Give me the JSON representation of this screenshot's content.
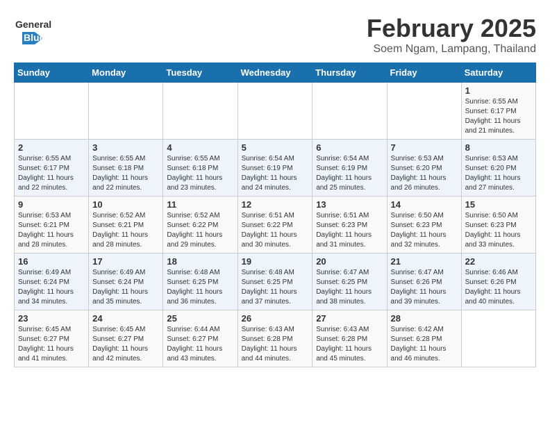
{
  "header": {
    "logo_general": "General",
    "logo_blue": "Blue",
    "month_title": "February 2025",
    "location": "Soem Ngam, Lampang, Thailand"
  },
  "days_of_week": [
    "Sunday",
    "Monday",
    "Tuesday",
    "Wednesday",
    "Thursday",
    "Friday",
    "Saturday"
  ],
  "weeks": [
    [
      {
        "day": "",
        "info": ""
      },
      {
        "day": "",
        "info": ""
      },
      {
        "day": "",
        "info": ""
      },
      {
        "day": "",
        "info": ""
      },
      {
        "day": "",
        "info": ""
      },
      {
        "day": "",
        "info": ""
      },
      {
        "day": "1",
        "info": "Sunrise: 6:55 AM\nSunset: 6:17 PM\nDaylight: 11 hours\nand 21 minutes."
      }
    ],
    [
      {
        "day": "2",
        "info": "Sunrise: 6:55 AM\nSunset: 6:17 PM\nDaylight: 11 hours\nand 22 minutes."
      },
      {
        "day": "3",
        "info": "Sunrise: 6:55 AM\nSunset: 6:18 PM\nDaylight: 11 hours\nand 22 minutes."
      },
      {
        "day": "4",
        "info": "Sunrise: 6:55 AM\nSunset: 6:18 PM\nDaylight: 11 hours\nand 23 minutes."
      },
      {
        "day": "5",
        "info": "Sunrise: 6:54 AM\nSunset: 6:19 PM\nDaylight: 11 hours\nand 24 minutes."
      },
      {
        "day": "6",
        "info": "Sunrise: 6:54 AM\nSunset: 6:19 PM\nDaylight: 11 hours\nand 25 minutes."
      },
      {
        "day": "7",
        "info": "Sunrise: 6:53 AM\nSunset: 6:20 PM\nDaylight: 11 hours\nand 26 minutes."
      },
      {
        "day": "8",
        "info": "Sunrise: 6:53 AM\nSunset: 6:20 PM\nDaylight: 11 hours\nand 27 minutes."
      }
    ],
    [
      {
        "day": "9",
        "info": "Sunrise: 6:53 AM\nSunset: 6:21 PM\nDaylight: 11 hours\nand 28 minutes."
      },
      {
        "day": "10",
        "info": "Sunrise: 6:52 AM\nSunset: 6:21 PM\nDaylight: 11 hours\nand 28 minutes."
      },
      {
        "day": "11",
        "info": "Sunrise: 6:52 AM\nSunset: 6:22 PM\nDaylight: 11 hours\nand 29 minutes."
      },
      {
        "day": "12",
        "info": "Sunrise: 6:51 AM\nSunset: 6:22 PM\nDaylight: 11 hours\nand 30 minutes."
      },
      {
        "day": "13",
        "info": "Sunrise: 6:51 AM\nSunset: 6:23 PM\nDaylight: 11 hours\nand 31 minutes."
      },
      {
        "day": "14",
        "info": "Sunrise: 6:50 AM\nSunset: 6:23 PM\nDaylight: 11 hours\nand 32 minutes."
      },
      {
        "day": "15",
        "info": "Sunrise: 6:50 AM\nSunset: 6:23 PM\nDaylight: 11 hours\nand 33 minutes."
      }
    ],
    [
      {
        "day": "16",
        "info": "Sunrise: 6:49 AM\nSunset: 6:24 PM\nDaylight: 11 hours\nand 34 minutes."
      },
      {
        "day": "17",
        "info": "Sunrise: 6:49 AM\nSunset: 6:24 PM\nDaylight: 11 hours\nand 35 minutes."
      },
      {
        "day": "18",
        "info": "Sunrise: 6:48 AM\nSunset: 6:25 PM\nDaylight: 11 hours\nand 36 minutes."
      },
      {
        "day": "19",
        "info": "Sunrise: 6:48 AM\nSunset: 6:25 PM\nDaylight: 11 hours\nand 37 minutes."
      },
      {
        "day": "20",
        "info": "Sunrise: 6:47 AM\nSunset: 6:25 PM\nDaylight: 11 hours\nand 38 minutes."
      },
      {
        "day": "21",
        "info": "Sunrise: 6:47 AM\nSunset: 6:26 PM\nDaylight: 11 hours\nand 39 minutes."
      },
      {
        "day": "22",
        "info": "Sunrise: 6:46 AM\nSunset: 6:26 PM\nDaylight: 11 hours\nand 40 minutes."
      }
    ],
    [
      {
        "day": "23",
        "info": "Sunrise: 6:45 AM\nSunset: 6:27 PM\nDaylight: 11 hours\nand 41 minutes."
      },
      {
        "day": "24",
        "info": "Sunrise: 6:45 AM\nSunset: 6:27 PM\nDaylight: 11 hours\nand 42 minutes."
      },
      {
        "day": "25",
        "info": "Sunrise: 6:44 AM\nSunset: 6:27 PM\nDaylight: 11 hours\nand 43 minutes."
      },
      {
        "day": "26",
        "info": "Sunrise: 6:43 AM\nSunset: 6:28 PM\nDaylight: 11 hours\nand 44 minutes."
      },
      {
        "day": "27",
        "info": "Sunrise: 6:43 AM\nSunset: 6:28 PM\nDaylight: 11 hours\nand 45 minutes."
      },
      {
        "day": "28",
        "info": "Sunrise: 6:42 AM\nSunset: 6:28 PM\nDaylight: 11 hours\nand 46 minutes."
      },
      {
        "day": "",
        "info": ""
      }
    ]
  ]
}
